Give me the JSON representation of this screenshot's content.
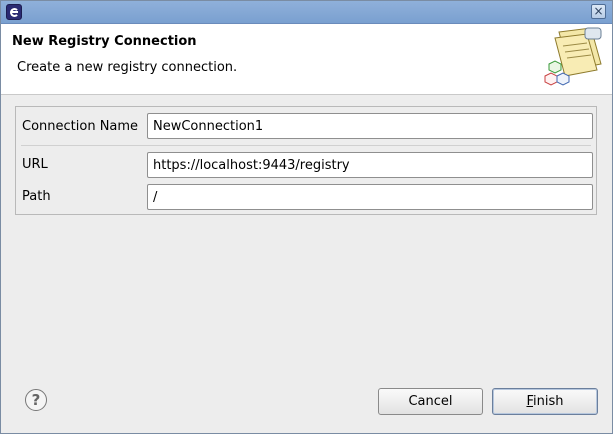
{
  "window": {
    "close_glyph": "×"
  },
  "header": {
    "title": "New Registry Connection",
    "description": "Create a new registry connection."
  },
  "form": {
    "connection_name": {
      "label": "Connection Name",
      "value": "NewConnection1"
    },
    "url": {
      "label": "URL",
      "value": "https://localhost:9443/registry"
    },
    "path": {
      "label": "Path",
      "value": "/"
    }
  },
  "buttons": {
    "help": "?",
    "cancel": "Cancel",
    "finish_mnemonic": "F",
    "finish_rest": "inish"
  },
  "icons": [
    "app-icon",
    "close-icon",
    "registry-wizard-icon",
    "help-icon"
  ],
  "colors": {
    "titlebar": "#7aa0d0",
    "dialog_background": "#ededed",
    "header_background": "#ffffff"
  }
}
